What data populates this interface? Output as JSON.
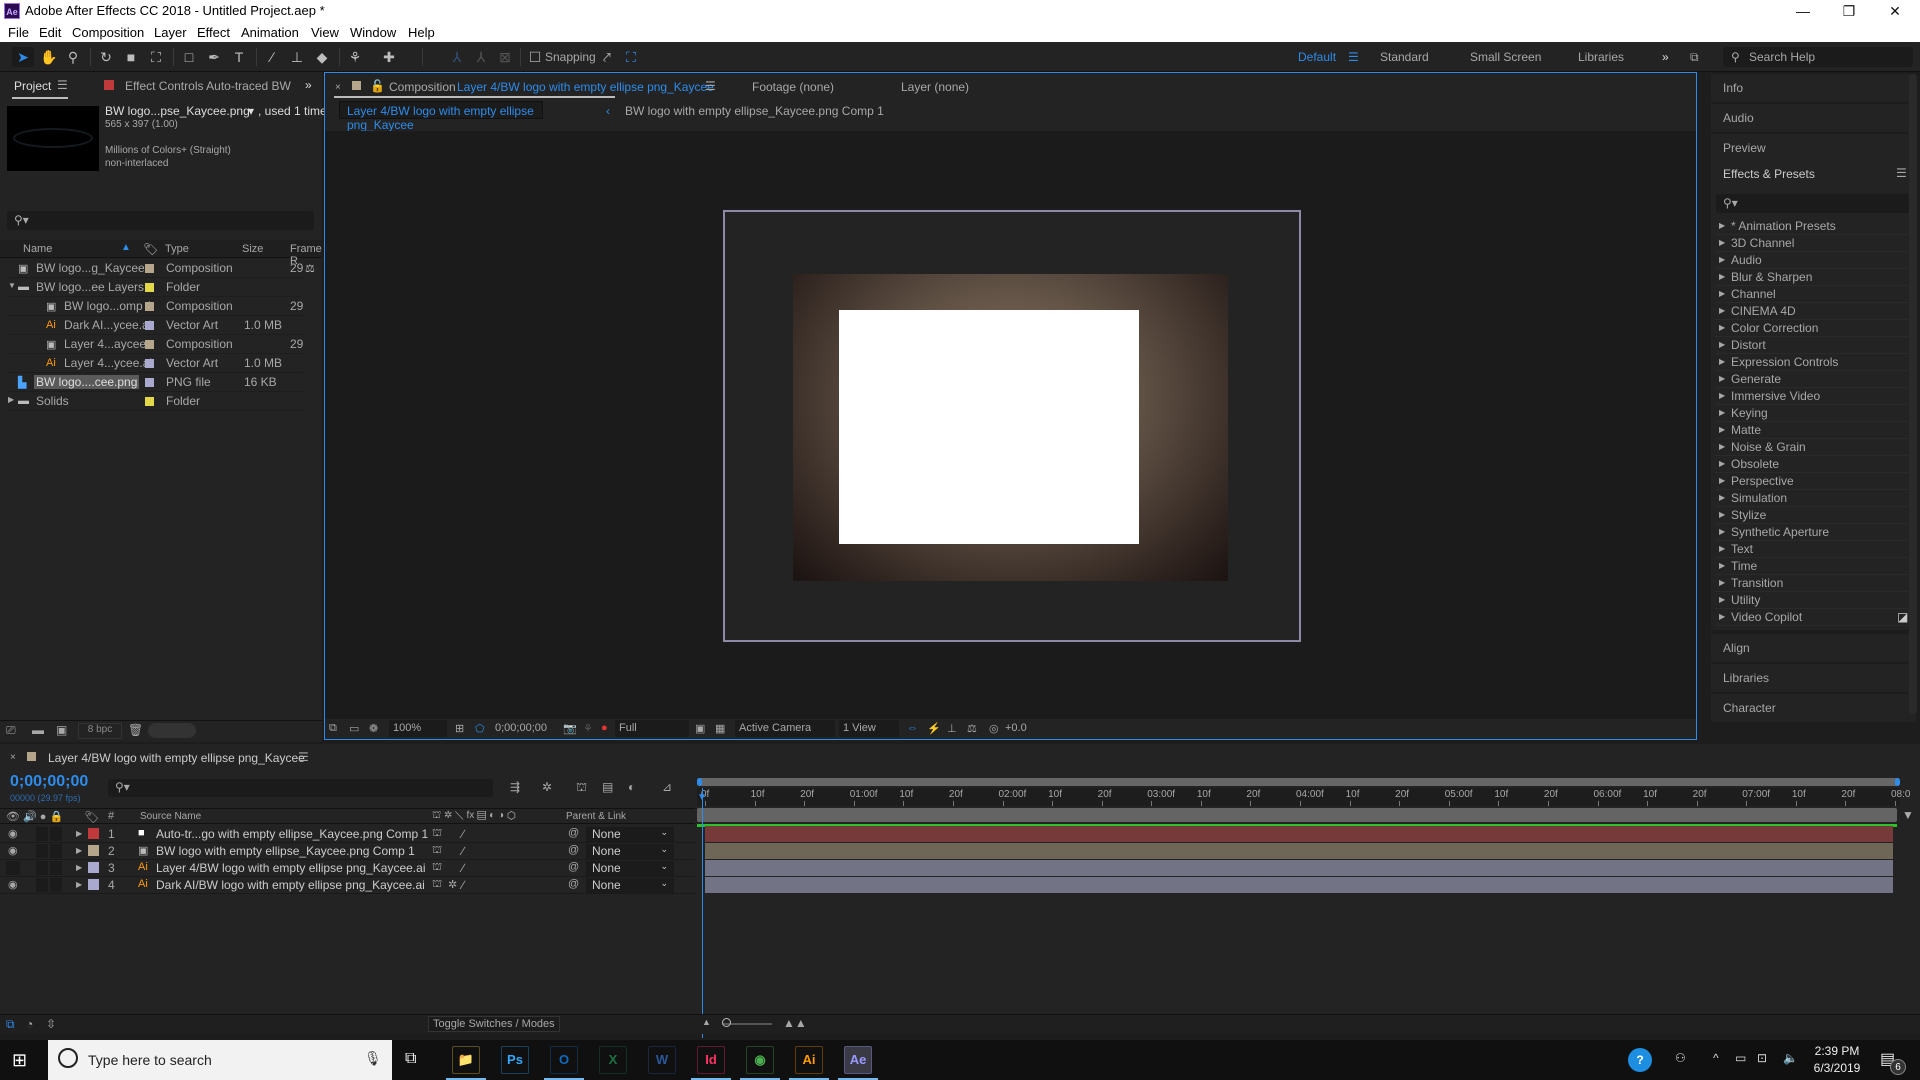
{
  "window": {
    "app_icon": "Ae",
    "title": "Adobe After Effects CC 2018 - Untitled Project.aep *",
    "controls": [
      "minimize-icon",
      "restore-icon",
      "close-icon"
    ]
  },
  "menu": [
    "File",
    "Edit",
    "Composition",
    "Layer",
    "Effect",
    "Animation",
    "View",
    "Window",
    "Help"
  ],
  "toolbar": {
    "snapping_label": "Snapping",
    "workspaces": [
      "Default",
      "Standard",
      "Small Screen",
      "Libraries"
    ],
    "active_workspace": "Default",
    "search_help_placeholder": "Search Help"
  },
  "project": {
    "tab_label": "Project",
    "effect_controls_label": "Effect Controls Auto-traced BW",
    "preview": {
      "name": "BW logo...pse_Kaycee.png",
      "used": ", used 1 time",
      "dims": "565 x 397 (1.00)",
      "colors": "Millions of Colors+ (Straight)",
      "interlace": "non-interlaced"
    },
    "search_placeholder": "",
    "columns": {
      "name": "Name",
      "type": "Type",
      "size": "Size",
      "frame": "Frame R"
    },
    "items": [
      {
        "name": "BW logo...g_Kaycee",
        "type": "Composition",
        "size": "",
        "frame": "29",
        "icon": "composition-icon",
        "label_color": "#b5a58a",
        "indent": 0
      },
      {
        "name": "BW logo...ee Layers",
        "type": "Folder",
        "size": "",
        "frame": "",
        "icon": "folder-icon",
        "label_color": "#e3d84a",
        "indent": 0,
        "expanded": true
      },
      {
        "name": "BW logo...omp 1",
        "type": "Composition",
        "size": "",
        "frame": "29",
        "icon": "composition-icon",
        "label_color": "#b5a58a",
        "indent": 1
      },
      {
        "name": "Dark AI...ycee.ai",
        "type": "Vector Art",
        "size": "1.0 MB",
        "frame": "",
        "icon": "illustrator-file-icon",
        "label_color": "#a9a9cf",
        "indent": 1
      },
      {
        "name": "Layer 4...aycee",
        "type": "Composition",
        "size": "",
        "frame": "29",
        "icon": "composition-icon",
        "label_color": "#b5a58a",
        "indent": 1
      },
      {
        "name": "Layer 4...ycee.ai",
        "type": "Vector Art",
        "size": "1.0 MB",
        "frame": "",
        "icon": "illustrator-file-icon",
        "label_color": "#a9a9cf",
        "indent": 1
      },
      {
        "name": "BW logo....cee.png",
        "type": "PNG file",
        "size": "16 KB",
        "frame": "",
        "icon": "png-file-icon",
        "label_color": "#a9a9cf",
        "indent": 0,
        "selected": true
      },
      {
        "name": "Solids",
        "type": "Folder",
        "size": "",
        "frame": "",
        "icon": "folder-icon",
        "label_color": "#e3d84a",
        "indent": 0,
        "expanded": false
      }
    ],
    "bpc": "8 bpc"
  },
  "viewer": {
    "comp_tab_prefix": "Composition",
    "comp_tab_name": "Layer 4/BW logo with empty ellipse png_Kaycee",
    "footage_tab": "Footage (none)",
    "layer_tab": "Layer (none)",
    "breadcrumb": [
      "Layer 4/BW logo with empty ellipse png_Kaycee",
      "BW logo with empty ellipse_Kaycee.png Comp 1"
    ],
    "footer": {
      "zoom": "100%",
      "timecode": "0;00;00;00",
      "resolution": "Full",
      "camera": "Active Camera",
      "views": "1 View",
      "exposure": "+0.0"
    }
  },
  "right_panels": {
    "collapsed_top": [
      "Info",
      "Audio",
      "Preview"
    ],
    "effects_title": "Effects & Presets",
    "effects": [
      "* Animation Presets",
      "3D Channel",
      "Audio",
      "Blur & Sharpen",
      "Channel",
      "CINEMA 4D",
      "Color Correction",
      "Distort",
      "Expression Controls",
      "Generate",
      "Immersive Video",
      "Keying",
      "Matte",
      "Noise & Grain",
      "Obsolete",
      "Perspective",
      "Simulation",
      "Stylize",
      "Synthetic Aperture",
      "Text",
      "Time",
      "Transition",
      "Utility",
      "Video Copilot"
    ],
    "collapsed_bottom": [
      "Align",
      "Libraries",
      "Character"
    ]
  },
  "timeline": {
    "tab_label": "Layer 4/BW logo with empty ellipse png_Kaycee",
    "timecode": "0;00;00;00",
    "frames": "00000 (29.97 fps)",
    "columns": {
      "num": "#",
      "source": "Source Name",
      "parent": "Parent & Link"
    },
    "layers": [
      {
        "num": "1",
        "name": "Auto-tr...go with empty ellipse_Kaycee.png Comp 1",
        "label_color": "#c0393b",
        "icon": "solid-icon",
        "visible": true,
        "parent": "None",
        "bar_color": "#773a3b"
      },
      {
        "num": "2",
        "name": "BW logo with empty ellipse_Kaycee.png Comp 1",
        "label_color": "#b5a58a",
        "icon": "composition-icon",
        "visible": true,
        "parent": "None",
        "bar_color": "#6e6656"
      },
      {
        "num": "3",
        "name": "Layer 4/BW logo with empty ellipse png_Kaycee.ai",
        "label_color": "#a9a9cf",
        "icon": "illustrator-file-icon",
        "visible": false,
        "parent": "None",
        "bar_color": "#727384"
      },
      {
        "num": "4",
        "name": "Dark AI/BW logo with empty ellipse png_Kaycee.ai",
        "label_color": "#a9a9cf",
        "icon": "illustrator-file-icon",
        "visible": true,
        "parent": "None",
        "bar_color": "#727384"
      }
    ],
    "ruler": [
      "0f",
      "10f",
      "20f",
      "01:00f",
      "10f",
      "20f",
      "02:00f",
      "10f",
      "20f",
      "03:00f",
      "10f",
      "20f",
      "04:00f",
      "10f",
      "20f",
      "05:00f",
      "10f",
      "20f",
      "06:00f",
      "10f",
      "20f",
      "07:00f",
      "10f",
      "20f",
      "08:0"
    ],
    "toggle_label": "Toggle Switches / Modes"
  },
  "taskbar": {
    "search_placeholder": "Type here to search",
    "apps": [
      {
        "name": "file-explorer",
        "label": "📁",
        "color": "#f2c94c"
      },
      {
        "name": "photoshop",
        "label": "Ps",
        "color": "#31a8ff"
      },
      {
        "name": "outlook",
        "label": "O",
        "color": "#0f6cbd"
      },
      {
        "name": "excel",
        "label": "X",
        "color": "#1e7145"
      },
      {
        "name": "word",
        "label": "W",
        "color": "#2b579a"
      },
      {
        "name": "indesign",
        "label": "Id",
        "color": "#ff3366"
      },
      {
        "name": "chrome",
        "label": "◉",
        "color": "#4caf50"
      },
      {
        "name": "illustrator",
        "label": "Ai",
        "color": "#ff9a00"
      },
      {
        "name": "after-effects",
        "label": "Ae",
        "color": "#9999ff"
      }
    ],
    "time": "2:39 PM",
    "date": "6/3/2019",
    "notifications": "6"
  }
}
